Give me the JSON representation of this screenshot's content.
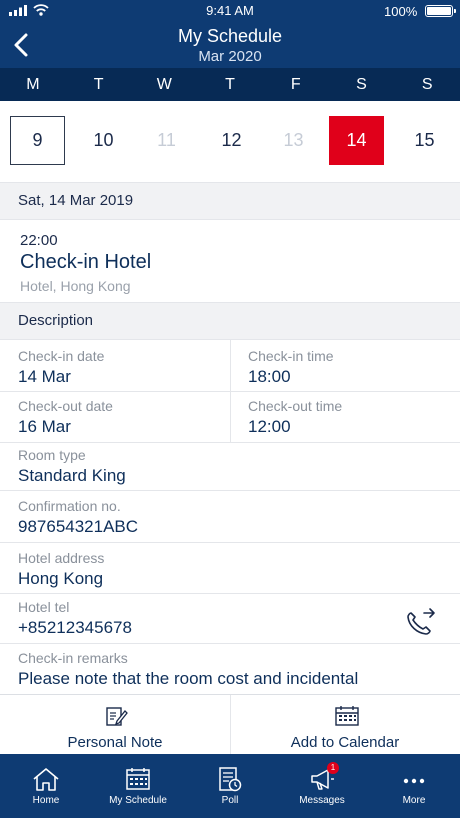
{
  "status": {
    "time": "9:41 AM",
    "battery": "100%"
  },
  "header": {
    "title": "My Schedule",
    "subtitle": "Mar 2020"
  },
  "weekdays": [
    "M",
    "T",
    "W",
    "T",
    "F",
    "S",
    "S"
  ],
  "days": [
    "9",
    "10",
    "11",
    "12",
    "13",
    "14",
    "15"
  ],
  "section_date": "Sat, 14 Mar 2019",
  "event": {
    "time": "22:00",
    "title": "Check-in Hotel",
    "location": "Hotel, Hong Kong"
  },
  "description_label": "Description",
  "details": {
    "checkin_date_label": "Check-in date",
    "checkin_date": "14 Mar",
    "checkin_time_label": "Check-in time",
    "checkin_time": "18:00",
    "checkout_date_label": "Check-out date",
    "checkout_date": "16 Mar",
    "checkout_time_label": "Check-out time",
    "checkout_time": "12:00",
    "room_type_label": "Room type",
    "room_type": "Standard King",
    "confirmation_label": "Confirmation no.",
    "confirmation": "987654321ABC",
    "address_label": "Hotel address",
    "address": "Hong Kong",
    "tel_label": "Hotel tel",
    "tel": "+85212345678",
    "remarks_label": "Check-in remarks",
    "remarks": "Please note that the room cost and incidental"
  },
  "actions": {
    "personal_note": "Personal Note",
    "add_calendar": "Add to Calendar"
  },
  "tabs": {
    "home": "Home",
    "schedule": "My Schedule",
    "poll": "Poll",
    "messages": "Messages",
    "messages_badge": "1",
    "more": "More"
  },
  "colors": {
    "primary": "#0e3b73",
    "weekday_bar": "#072a55",
    "selected": "#e0001a"
  }
}
